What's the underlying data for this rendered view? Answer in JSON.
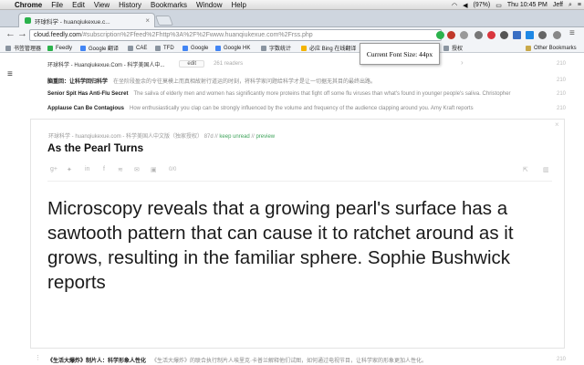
{
  "menubar": {
    "items": [
      "Chrome",
      "File",
      "Edit",
      "View",
      "History",
      "Bookmarks",
      "Window",
      "Help"
    ],
    "time": "Thu 10:45 PM",
    "user": "Jeff",
    "battery": "(97%)"
  },
  "tab": {
    "title": "环球科学 - huanqiukexue.c..."
  },
  "omnibox": {
    "host": "cloud.feedly.com",
    "path": "/#subscription%2Ffeed%2Fhttp%3A%2F%2Fwww.huanqiukexue.com%2Frss.php"
  },
  "tooltip": {
    "text": "Current Font Size: 44px"
  },
  "bookmarks": {
    "items": [
      "书签管理器",
      "Feedly",
      "Google 翻译",
      "CAE",
      "TFD",
      "Google",
      "Google HK",
      "字数统计",
      "必应 Bing 在线翻译",
      "授权"
    ],
    "other": "Other Bookmarks"
  },
  "feed": {
    "header_title": "环球科学 - Huanqiukexue.Com - 科学美国人中...",
    "header_edit": "edit",
    "header_readers": "261 readers",
    "rows": [
      {
        "title": "脑重回：让科学回归科学",
        "snippet": "在坐阶段盈余的令往莫模上而真相故射行道运的时刻，将科学家问题给科学才是让一切据无其目的最终出路。",
        "count": "210"
      },
      {
        "title": "Senior Spit Has Anti-Flu Secret",
        "snippet": "The saliva of elderly men and women has significantly more proteins that fight off some flu viruses than what's found in younger people's saliva. Christopher",
        "count": "210"
      },
      {
        "title": "Applause Can Be Contagious",
        "snippet": "How enthusiastically you clap can be strongly influenced by the volume and frequency of the audience clapping around you. Amy Kraft reports",
        "count": "210"
      }
    ],
    "top_count": "210"
  },
  "card": {
    "meta_source": "环球科学 - huanqiukexue.com - 科学美国人中文版（独家授权） 87d",
    "meta_keep": "keep unread",
    "meta_preview": "preview",
    "title": "As the Pearl Turns",
    "article": "Microscopy reveals that a growing pearl's surface has a sawtooth pattern that can cause it to ratchet around as it grows, resulting in the familiar sphere. Sophie Bushwick reports",
    "share_count": "0/0"
  },
  "bottom_row": {
    "title": "《生活大爆炸》制片人：科学形象人性化",
    "snippet": "《生活大爆炸》的联合执行制片人埃里克·卡普兰解释他们试图，如何通过电视节目，让科学家的形象更加人性化。",
    "count": "210"
  },
  "colors": {
    "accent_green": "#3fa35b",
    "tab_bg": "#cfd6df"
  }
}
